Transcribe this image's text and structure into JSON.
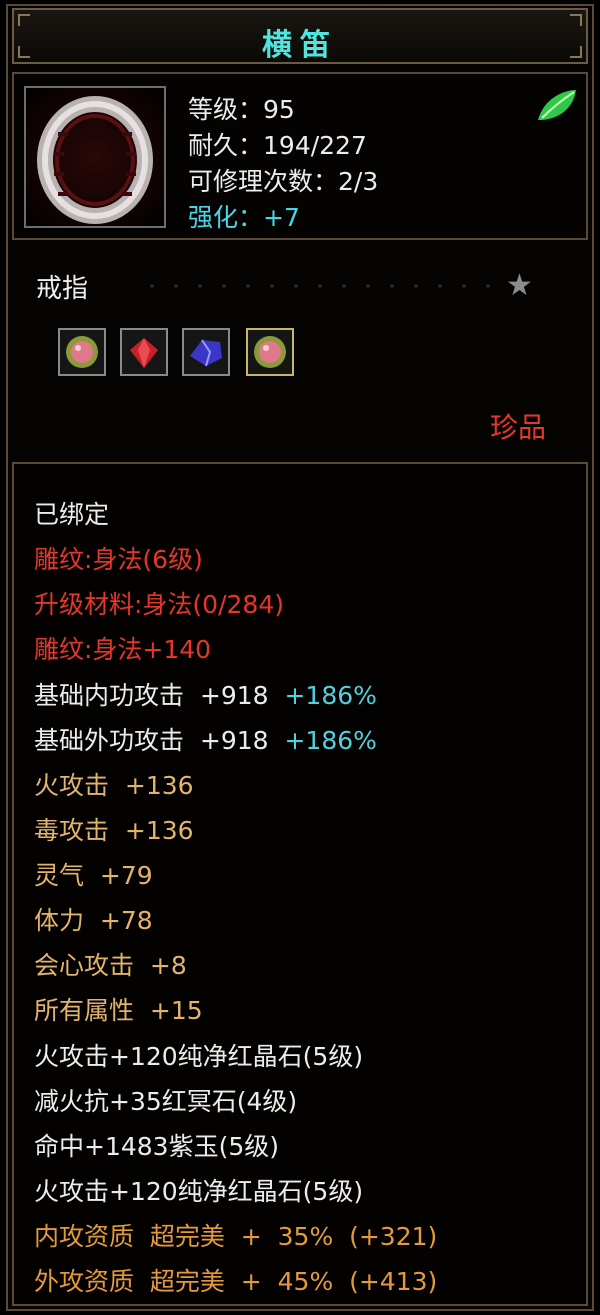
{
  "title": "横笛",
  "stats": {
    "level_label": "等级：",
    "level_value": "95",
    "durability_label": "耐久：",
    "durability_value": "194/227",
    "repair_label": "可修理次数：",
    "repair_value": "2/3",
    "enhance_label": "强化：",
    "enhance_value": "+7"
  },
  "slot": "戒指",
  "quality": "珍品",
  "gems": [
    "pink-gem",
    "red-gem",
    "blue-gem",
    "pink-gem"
  ],
  "colors": {
    "title": "#4fe6e0",
    "red": "#e4362a",
    "gold": "#e2b36a",
    "orange": "#e59a3a",
    "cyan": "#4fd1e0"
  },
  "attributes": {
    "bound": "已绑定",
    "carve1": "雕纹:身法(6级)",
    "upgrade": "升级材料:身法(0/284)",
    "carve2": "雕纹:身法+140",
    "base_inner": "基础内功攻击  +918",
    "base_inner_pct": "+186%",
    "base_outer": "基础外功攻击  +918",
    "base_outer_pct": "+186%",
    "fire_atk": "火攻击  +136",
    "poison_atk": "毒攻击  +136",
    "spirit": "灵气  +79",
    "stamina": "体力  +78",
    "crit": "会心攻击  +8",
    "all_attr": "所有属性  +15",
    "gem1": "火攻击+120纯净红晶石(5级)",
    "gem2": "减火抗+35红冥石(4级)",
    "gem3": "命中+1483紫玉(5级)",
    "gem4": "火攻击+120纯净红晶石(5级)",
    "inner_quality": "内攻资质  超完美  +  35%  (+321)",
    "outer_quality": "外攻资质  超完美  +  45%  (+413)"
  }
}
